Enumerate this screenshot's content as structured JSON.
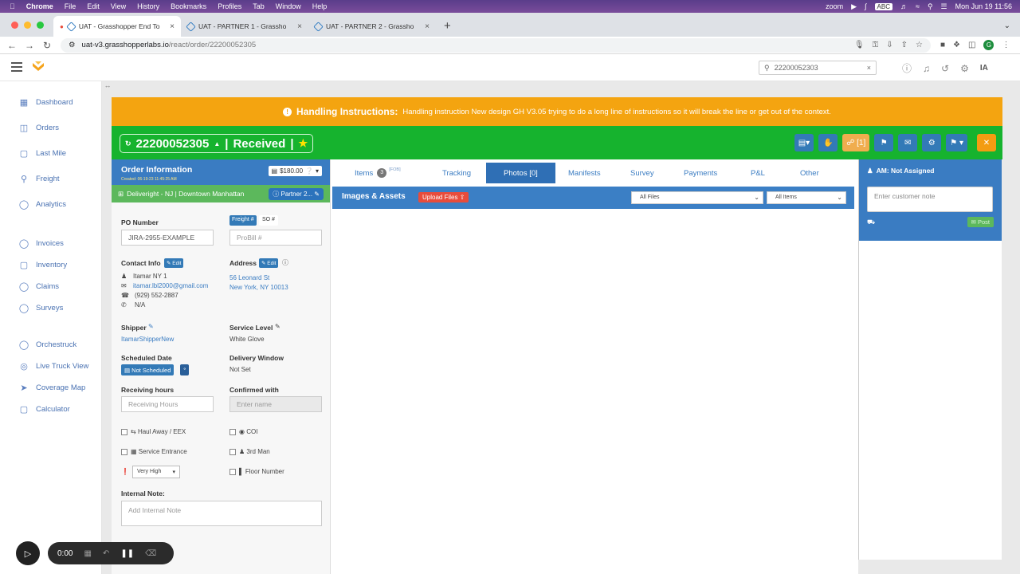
{
  "macos": {
    "app": "Chrome",
    "menus": [
      "File",
      "Edit",
      "View",
      "History",
      "Bookmarks",
      "Profiles",
      "Tab",
      "Window",
      "Help"
    ],
    "zoom": "zoom",
    "input_source": "ABC",
    "clock": "Mon Jun 19  11:56"
  },
  "browser": {
    "tabs": [
      {
        "title": "UAT - Grasshopper End To"
      },
      {
        "title": "UAT - PARTNER 1 - Grassho"
      },
      {
        "title": "UAT - PARTNER 2 - Grassho"
      }
    ],
    "url_host": "uat-v3.grasshopperlabs.io",
    "url_path": "/react/order/22200052305"
  },
  "header": {
    "search_value": "22200052303",
    "user_initials": "IA"
  },
  "sidebar": {
    "group1": [
      {
        "label": "Dashboard",
        "icon": "dashboard-icon"
      },
      {
        "label": "Orders",
        "icon": "orders-icon"
      },
      {
        "label": "Last Mile",
        "icon": "last-mile-icon"
      },
      {
        "label": "Freight",
        "icon": "freight-icon"
      },
      {
        "label": "Analytics",
        "icon": "analytics-icon"
      }
    ],
    "group2": [
      {
        "label": "Invoices",
        "icon": "invoices-icon"
      },
      {
        "label": "Inventory",
        "icon": "inventory-icon"
      },
      {
        "label": "Claims",
        "icon": "claims-icon"
      },
      {
        "label": "Surveys",
        "icon": "surveys-icon"
      }
    ],
    "group3": [
      {
        "label": "Orchestruck",
        "icon": "orchestruck-icon"
      },
      {
        "label": "Live Truck View",
        "icon": "live-truck-icon"
      },
      {
        "label": "Coverage Map",
        "icon": "coverage-map-icon"
      },
      {
        "label": "Calculator",
        "icon": "calculator-icon"
      }
    ]
  },
  "handling": {
    "title": "Handling Instructions:",
    "text": "Handling instruction New design GH V3.05 trying to do a long line of instructions so it will break the line or get out of the context."
  },
  "order": {
    "number": "22200052305",
    "separator1": "|",
    "status": "Received",
    "separator2": "|",
    "link_count": "[1]"
  },
  "info": {
    "title": "Order Information",
    "created": "Created: 06-19-23 11:45:25 AM",
    "price": "$180.00",
    "partner_row": "Deliveright - NJ | Downtown Manhattan",
    "partner_badge": "Partner 2...",
    "po_label": "PO Number",
    "po_value": "JIRA-2955-EXAMPLE",
    "freight_tag": "Freight #",
    "so_tag": "SO #",
    "probill_placeholder": "ProBill #",
    "contact_label": "Contact Info",
    "edit": "Edit",
    "contact_name": "Itamar NY 1",
    "contact_email": "itamar.lbl2000@gmail.com",
    "contact_phone": "(929) 552-2887",
    "contact_other": "N/A",
    "address_label": "Address",
    "address_line1": "56 Leonard St",
    "address_line2": "New York, NY 10013",
    "shipper_label": "Shipper",
    "shipper_value": "ItamarShipperNew",
    "service_label": "Service Level",
    "service_value": "White Glove",
    "scheduled_label": "Scheduled Date",
    "scheduled_value": "Not Scheduled",
    "window_label": "Delivery Window",
    "window_value": "Not Set",
    "receiving_label": "Receiving hours",
    "receiving_placeholder": "Receiving Hours",
    "confirmed_label": "Confirmed with",
    "confirmed_placeholder": "Enter name",
    "haul_away": "Haul Away / EEX",
    "coi": "COI",
    "service_entrance": "Service Entrance",
    "third_man": "3rd Man",
    "priority": "Very High",
    "floor_number": "Floor Number",
    "internal_label": "Internal Note:",
    "internal_placeholder": "Add Internal Note"
  },
  "center": {
    "tabs": [
      {
        "label": "Items",
        "count": "3",
        "extra": "[FOB]"
      },
      {
        "label": "Tracking"
      },
      {
        "label": "Photos [0]"
      },
      {
        "label": "Manifests"
      },
      {
        "label": "Survey"
      },
      {
        "label": "Payments"
      },
      {
        "label": "P&L"
      },
      {
        "label": "Other"
      }
    ],
    "section_title": "Images & Assets",
    "upload_label": "Upload Files",
    "filter_files": "All Files",
    "filter_items": "All Items"
  },
  "right": {
    "am_label": "AM: Not Assigned",
    "note_placeholder": "Enter customer note",
    "post_label": "Post"
  },
  "recorder": {
    "time": "0:00"
  }
}
